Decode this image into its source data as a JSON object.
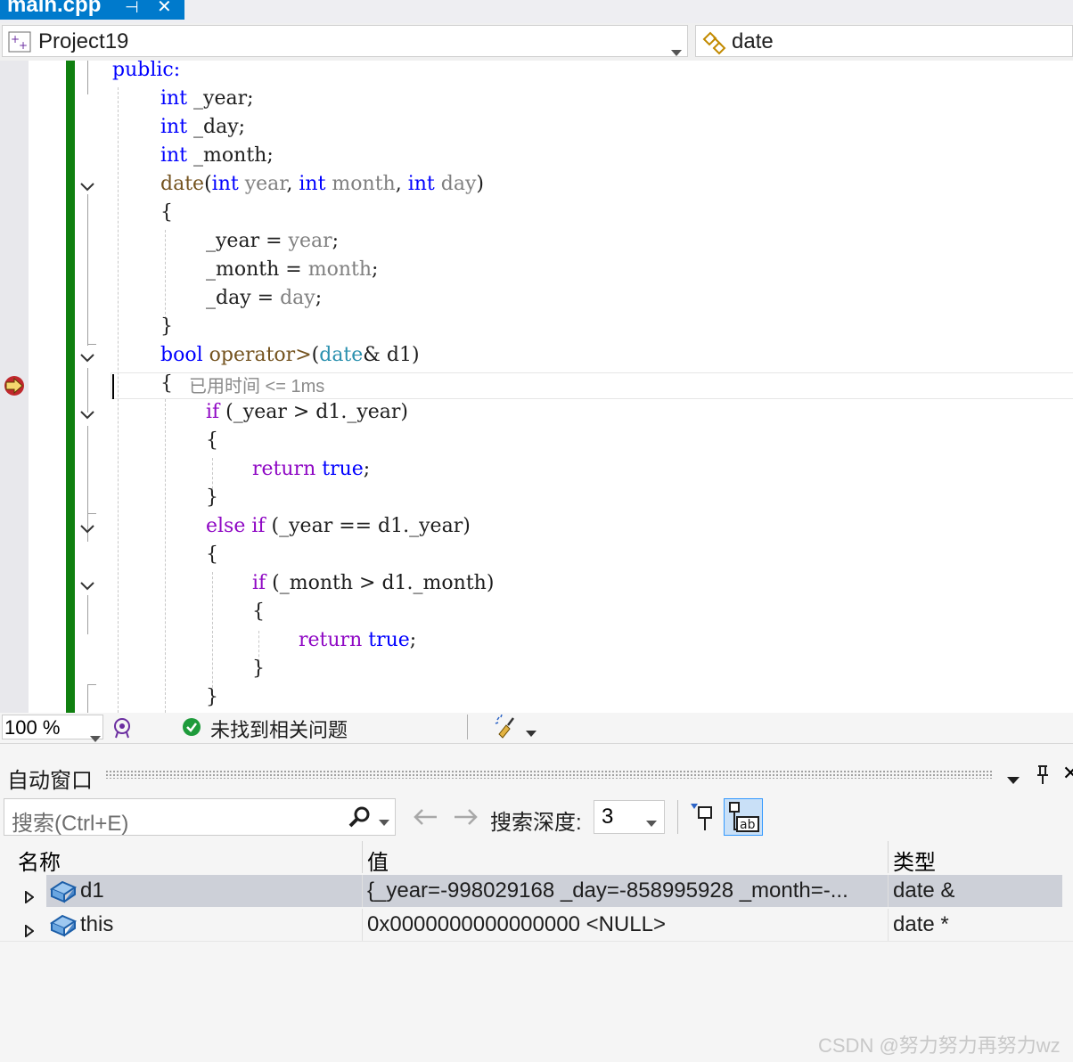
{
  "tab": {
    "title": "main.cpp",
    "pin_glyph": "⊣",
    "close_glyph": "✕"
  },
  "navbar": {
    "project": "Project19",
    "member": "date"
  },
  "code": {
    "public": "public:",
    "l1_type": "int",
    "l1_rest": " _year;",
    "l2_type": "int",
    "l2_rest": " _day;",
    "l3_type": "int",
    "l3_rest": " _month;",
    "ctor_name": "date",
    "ctor_open": "(",
    "int": "int",
    "p_year": "year",
    "comma": ", ",
    "p_month": "month",
    "p_day": "day",
    "ctor_close": ")",
    "brace_open": "{",
    "brace_close": "}",
    "a1_mem": "_year",
    "a1_eq": " = ",
    "a1_val": "year",
    "a_semi": ";",
    "a2_mem": "_month",
    "a2_val": "month",
    "a3_mem": "_day",
    "a3_val": "day",
    "bool": "bool",
    "operator": "operator>",
    "op_open": "(",
    "op_type": "date",
    "op_rest": "& d1)",
    "elapsed": "已用时间 <= 1ms",
    "if": "if",
    "if1_rest": " (_year > d1._year)",
    "return": "return",
    "true": "true",
    "else_if": "else if",
    "if2_rest": " (_year == d1._year)",
    "if3_rest": " (_month > d1._month)"
  },
  "status": {
    "zoom": "100 %",
    "issues": "未找到相关问题"
  },
  "autos": {
    "title": "自动窗口",
    "search_placeholder": "搜索(Ctrl+E)",
    "depth_label": "搜索深度:",
    "depth_value": "3",
    "columns": {
      "name": "名称",
      "value": "值",
      "type": "类型"
    },
    "rows": [
      {
        "name": "d1",
        "value": "{_year=-998029168 _day=-858995928 _month=-...",
        "type": "date &"
      },
      {
        "name": "this",
        "value": "0x0000000000000000 <NULL>",
        "type": "date *"
      }
    ]
  },
  "watermark": "CSDN @努力努力再努力wz",
  "colors": {
    "accent": "#007acc",
    "change_bar": "#108010",
    "keyword": "#0000ff",
    "control": "#8f08c4",
    "function": "#74531f",
    "type": "#2b91af",
    "param": "#808080"
  }
}
